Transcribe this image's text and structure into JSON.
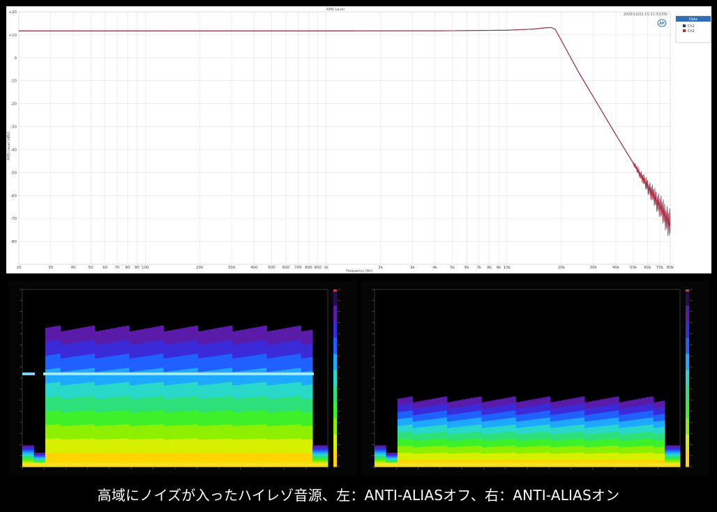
{
  "chart_data": [
    {
      "type": "line",
      "title": "RMS Level",
      "timestamp": "2025/12/01 15:11:31(59)",
      "xlabel": "Frequency (Hz)",
      "ylabel": "RMS Level (dBV)",
      "x_scale": "log",
      "xlim": [
        20,
        80000
      ],
      "ylim": [
        -90,
        20
      ],
      "x_tick_labels": [
        "20",
        "30",
        "40",
        "50",
        "60",
        "70",
        "80",
        "90",
        "100",
        "200",
        "300",
        "400",
        "500",
        "600",
        "700",
        "800",
        "900",
        "1k",
        "2k",
        "3k",
        "4k",
        "5k",
        "6k",
        "7k",
        "8k",
        "9k",
        "10k",
        "20k",
        "30k",
        "40k",
        "50k",
        "60k",
        "70k",
        "80k"
      ],
      "y_tick_labels": [
        "+20",
        "+10",
        "0",
        "-10",
        "-20",
        "-30",
        "-40",
        "-50",
        "-60",
        "-70",
        "-80"
      ],
      "legend": {
        "title": "Data",
        "placement": "top-right",
        "entries": [
          "Ch1",
          "Ch2"
        ]
      },
      "series": [
        {
          "name": "Ch1",
          "color": "#1f3f8f",
          "x": [
            20,
            100,
            1000,
            5000,
            10000,
            14000,
            16000,
            17500,
            18500,
            20000,
            22000,
            25000,
            30000,
            40000,
            50000,
            60000,
            70000,
            80000
          ],
          "y": [
            11.7,
            11.7,
            11.7,
            11.8,
            12.0,
            12.5,
            13.0,
            13.2,
            12.4,
            7.5,
            1.5,
            -6.5,
            -17.0,
            -33.5,
            -46.0,
            -56.0,
            -64.5,
            -73.0
          ]
        },
        {
          "name": "Ch2",
          "color": "#c0282a",
          "x": [
            20,
            100,
            1000,
            5000,
            10000,
            14000,
            16000,
            17500,
            18500,
            20000,
            22000,
            25000,
            30000,
            40000,
            50000,
            60000,
            70000,
            80000
          ],
          "y": [
            11.7,
            11.7,
            11.7,
            11.8,
            12.0,
            12.5,
            13.0,
            13.2,
            12.4,
            7.5,
            1.5,
            -6.5,
            -17.0,
            -33.5,
            -46.0,
            -56.0,
            -64.5,
            -73.0
          ]
        }
      ],
      "brand_mark": "AP"
    },
    {
      "type": "heatmap",
      "description_label": "ANTI-ALIAS off",
      "noise_band_top_fraction": 0.78,
      "tone_line_fraction": 0.5
    },
    {
      "type": "heatmap",
      "description_label": "ANTI-ALIAS on",
      "noise_band_top_fraction": 0.38,
      "tone_line_fraction": null
    }
  ],
  "caption": "高域にノイズが入ったハイレゾ音源、左：ANTI-ALIASオフ、右：ANTI-ALIASオン",
  "colors": {
    "ch1": "#1f3f8f",
    "ch2": "#c0282a",
    "legend_header": "#2e6fb7",
    "caption": "#ffffff"
  }
}
